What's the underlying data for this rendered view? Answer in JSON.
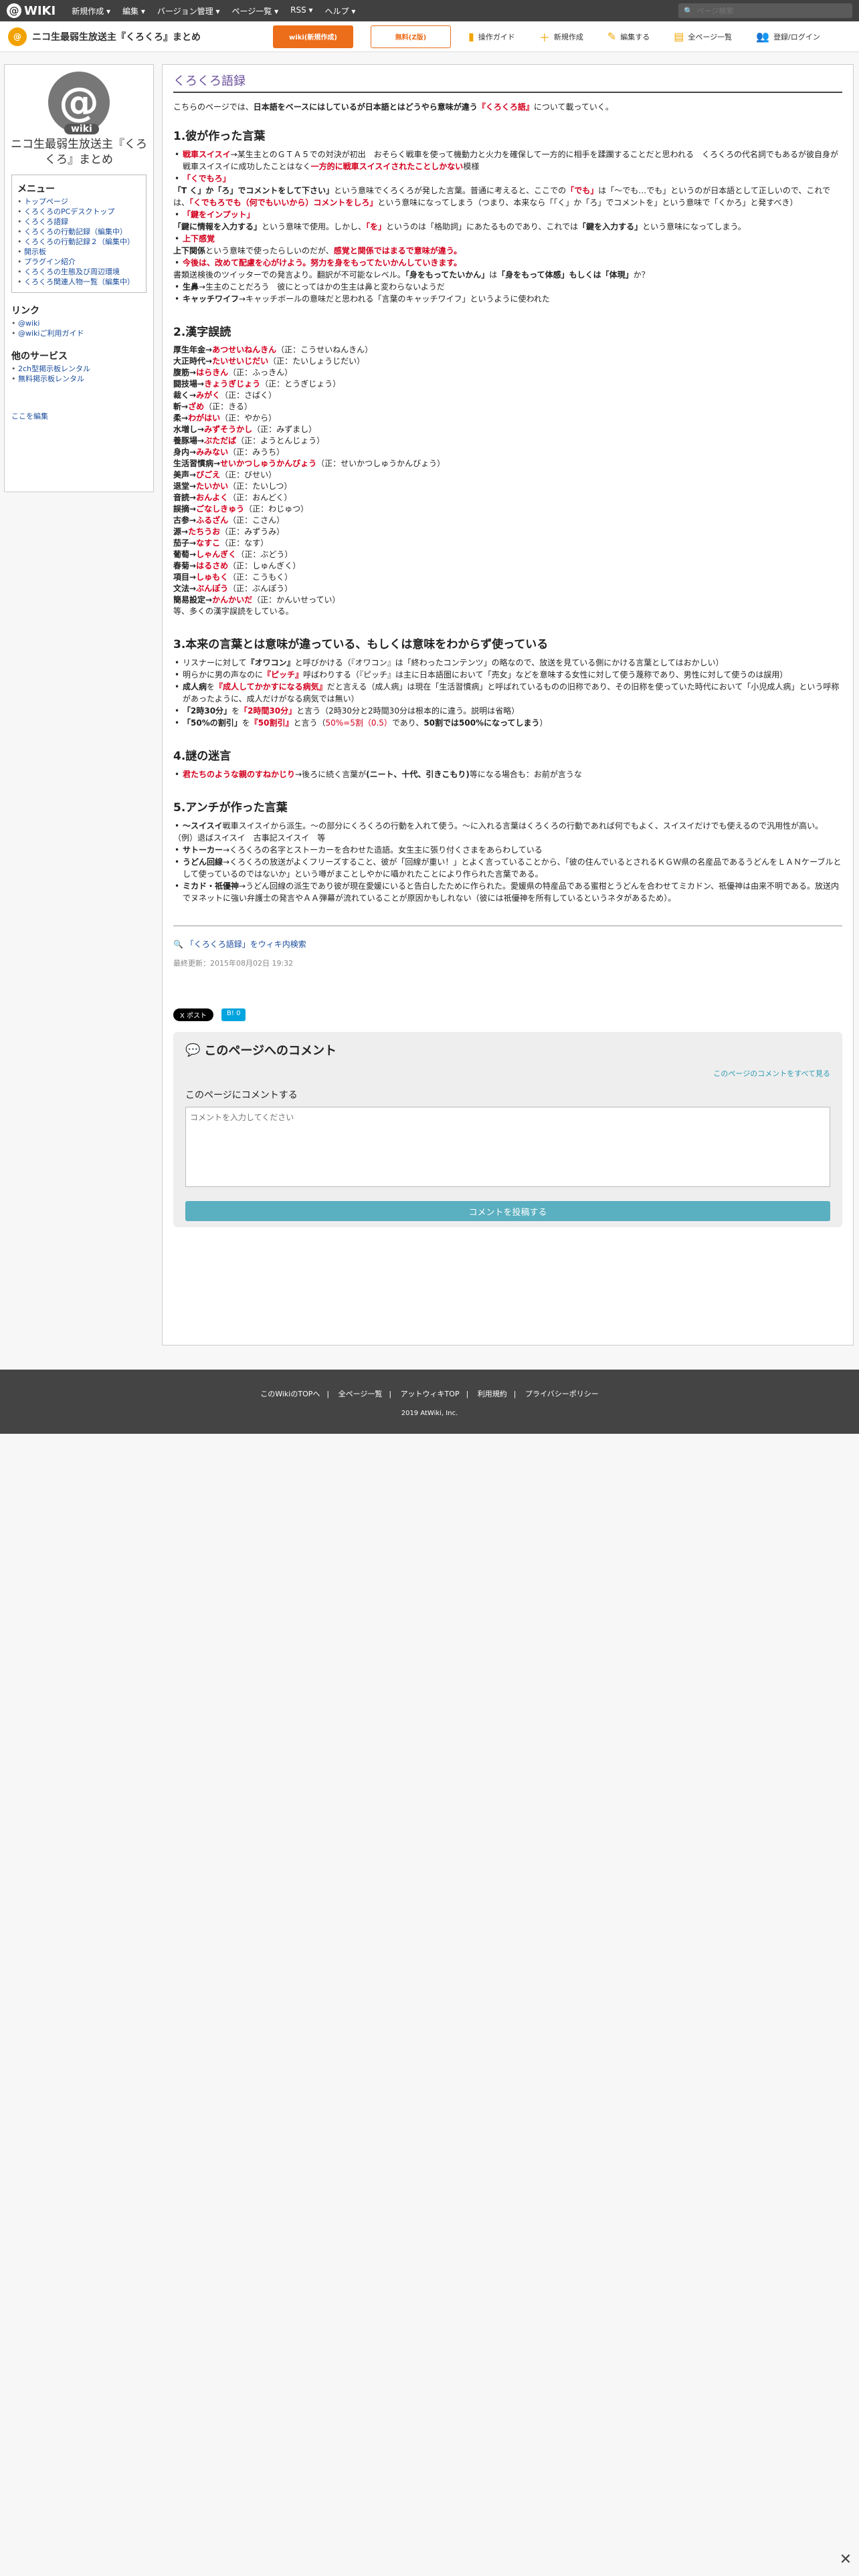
{
  "topbar": {
    "logo": "WIKI",
    "nav": [
      "新規作成 ▾",
      "編集 ▾",
      "バージョン管理 ▾",
      "ページ一覧 ▾",
      "RSS ▾",
      "ヘルプ ▾"
    ],
    "search_placeholder": "ページ検索"
  },
  "toolbar": {
    "site_title": "ニコ生最弱生放送主『くろくろ』まとめ",
    "btn_wiki": "wiki(新規作成)",
    "btn_free": "無料(Z版)",
    "items": [
      "操作ガイド",
      "新規作成",
      "編集する",
      "全ページ一覧",
      "登録/ログイン"
    ]
  },
  "sidebar": {
    "name": "ニコ生最弱生放送主『くろくろ』まとめ",
    "menu_title": "メニュー",
    "menu": [
      "トップページ",
      "くろくろのPCデスクトップ",
      "くろくろ語録",
      "くろくろの行動記録（編集中）",
      "くろくろの行動記録２（編集中）",
      "開示板",
      "プラグイン紹介",
      "くろくろの生態及び周辺環境",
      "くろくろ関連人物一覧（編集中）"
    ],
    "links_title": "リンク",
    "links": [
      "@wiki",
      "@wikiご利用ガイド"
    ],
    "other_title": "他のサービス",
    "other": [
      "2ch型掲示板レンタル",
      "無料掲示板レンタル"
    ],
    "edit": "ここを編集"
  },
  "main": {
    "title": "くろくろ語録",
    "intro_a": "こちらのページでは、",
    "intro_b": "日本語をベースにはしているが日本語とはどうやら意味が違う",
    "intro_c": "『くろくろ語』",
    "intro_d": "について載っていく。",
    "s1_title": "1.彼が作った言葉",
    "s1": {
      "a1": "戦車スイスイ",
      "a2": "→某生主とのＧＴＡ５での対決が初出　おそらく戦車を使って機動力と火力を確保して一方的に相手を蹂躙することだと思われる　くろくろの代名詞でもあるが彼自身が戦車スイスイに成功したことはなく",
      "a3": "一方的に戦車スイスイされたことしかない",
      "a4": "模様",
      "b1": "「くでもろ」",
      "c1": "「T く」か「ろ」でコメントをして下さい」",
      "c2": "という意味でくろくろが発した言葉。普通に考えると、ここでの",
      "c3": "「でも」",
      "c4": "は「〜でも…でも」というのが日本語として正しいので、これでは、",
      "c5": "「くでもろでも（何でもいいから）コメントをしろ」",
      "c6": "という意味になってしまう（つまり、本来なら「「く」か「ろ」でコメントを」という意味で「くかろ」と発すべき）",
      "d1": "「鍵をインプット」",
      "e1": "「鍵に情報を入力する」",
      "e2": "という意味で使用。しかし、",
      "e3": "「を」",
      "e4": "というのは「格助詞」にあたるものであり、これでは",
      "e5": "「鍵を入力する」",
      "e6": "という意味になってしまう。",
      "f1": "上下感覚",
      "g1": "上下関係",
      "g2": "という意味で使ったらしいのだが、",
      "g3": "感覚と関係ではまるで意味が違う。",
      "h1": "今後は、改めて配慮を心がけよう。努力を身をもってたいかんしていきます。",
      "i1": "書類送検後のツイッターでの発言より。翻訳が不可能なレベル。",
      "i2": "「身をもってたいかん」",
      "i3": "は",
      "i4": "「身をもって体感」もしくは「体現」",
      "i5": "か？",
      "j1": "生鼻",
      "j2": "→生主のことだろう　彼にとってはかの生主は鼻と変わらないようだ",
      "k1": "キャッチワイフ",
      "k2": "→キャッチボールの意味だと思われる「言葉のキャッチワイフ」というように使われた"
    },
    "s2_title": "2.漢字誤読",
    "s2": [
      {
        "w": "厚生年金→",
        "r": "あつせいねんきん",
        "n": "（正：こうせいねんきん）"
      },
      {
        "w": "大正時代→",
        "r": "たいせいじだい",
        "n": "（正：たいしょうじだい）"
      },
      {
        "w": "腹筋→",
        "r": "はらきん",
        "n": "（正：ふっきん）"
      },
      {
        "w": "闘技場→",
        "r": "きょうぎじょう",
        "n": "（正：とうぎじょう）"
      },
      {
        "w": "裁く→",
        "r": "みがく",
        "n": "（正：さばく）"
      },
      {
        "w": "斬→",
        "r": "ざめ",
        "n": "（正：きる）"
      },
      {
        "w": "柔→",
        "r": "わがはい",
        "n": "（正：やから）"
      },
      {
        "w": "水増し→",
        "r": "みずそうかし",
        "n": "（正：みずまし）"
      },
      {
        "w": "養豚場→",
        "r": "ぶただば",
        "n": "（正：ようとんじょう）"
      },
      {
        "w": "身内→",
        "r": "みみない",
        "n": "（正：みうち）"
      },
      {
        "w": "生活習慣病→",
        "r": "せいかつしゅうかんびょう",
        "n": "（正：せいかつしゅうかんびょう）"
      },
      {
        "w": "美声→",
        "r": "びごえ",
        "n": "（正：びせい）"
      },
      {
        "w": "退堂→",
        "r": "たいかい",
        "n": "（正：たいしつ）"
      },
      {
        "w": "音読→",
        "r": "おんよく",
        "n": "（正：おんどく）"
      },
      {
        "w": "誤摘→",
        "r": "ごなしきゅう",
        "n": "（正：わじゅつ）"
      },
      {
        "w": "古参→",
        "r": "ふるざん",
        "n": "（正：こさん）"
      },
      {
        "w": "源→",
        "r": "たちうお",
        "n": "（正：みずうみ）"
      },
      {
        "w": "茄子→",
        "r": "なすこ",
        "n": "（正：なす）"
      },
      {
        "w": "葡萄→",
        "r": "しゃんぎく",
        "n": "（正：ぶどう）"
      },
      {
        "w": "春菊→",
        "r": "はるさめ",
        "n": "（正：しゅんぎく）"
      },
      {
        "w": "項目→",
        "r": "しゅもく",
        "n": "（正：こうもく）"
      },
      {
        "w": "文法→",
        "r": "ぶんぽう",
        "n": "（正：ぶんぽう）"
      },
      {
        "w": "簡易設定→",
        "r": "かんかいだ",
        "n": "（正：かんいせってい）"
      }
    ],
    "s2_note": "等、多くの漢字誤読をしている。",
    "s3_title": "3.本来の言葉とは意味が違っている、もしくは意味をわからず使っている",
    "s3": {
      "a1": "リスナーに対して",
      "a2": "『オワコン』",
      "a3": "と呼びかける（『オワコン』は「終わったコンテンツ」の略なので、放送を見ている側にかける言葉としてはおかしい）",
      "b1": "明らかに男の声なのに",
      "b2": "『ピッチ』",
      "b3": "呼ばわりする（『ピッチ』は主に日本語圏において「売女」などを意味する女性に対して使う蔑称であり、男性に対して使うのは誤用）",
      "c1": "成人病",
      "c2": "を",
      "c3": "『成人してかかすになる病気』",
      "c4": "だと言える（成人病」は現在「生活習慣病」と呼ばれているものの旧称であり、その旧称を使っていた時代において「小児成人病」という呼称があったように、成人だけがなる病気では無い）",
      "d1": "「2時30分」",
      "d2": "を",
      "d3": "「2時間30分」",
      "d4": "と言う（2時30分と2時間30分は根本的に違う。説明は省略）",
      "e1": "「50%の割引」",
      "e2": "を",
      "e3": "『50割引』",
      "e4": "と言う（",
      "e5": "50%=5割（0.5）",
      "e6": "であり、",
      "e7": "50割では500%になってしまう",
      "e8": "）"
    },
    "s4_title": "4.謎の迷言",
    "s4": {
      "a1": "君たちのような親のすねかじり",
      "a2": "→後ろに続く言葉が",
      "a3": "(ニート、十代、引きこもり)",
      "a4": "等になる場合も：お前が言うな"
    },
    "s5_title": "5.アンチが作った言葉",
    "s5": {
      "a1": "〜スイスイ",
      "a2": "戦車スイスイから派生。〜の部分にくろくろの行動を入れて使う。〜に入れる言葉はくろくろの行動であれば何でもよく、スイスイだけでも使えるので汎用性が高い。",
      "b1": "（例）退ばスイスイ　古事記スイスイ　等",
      "c1": "サトーカー",
      "c2": "くろくろの名字とストーカーを合わせた造語。女生主に張り付くさまをあらわしている",
      "d1": "うどん回線",
      "d2": "くろくろの放送がよくフリーズすること、彼が「回線が重い！」とよく言っていることから、「彼の住んでいるとされるＫＧＷ県の名産品であるうどんをＬＡＮケーブルとして使っているのではないか」という噂がまことしやかに囁かれたことにより作られた言葉である。",
      "e1": "ミカド・祇優神",
      "e2": "うどん回線の派生であり彼が現在愛媛にいると告白したために作られた。愛媛県の特産品である蜜柑とうどんを合わせてミカドン、祇優神は由来不明である。放送内でヌネットに強い弁護士の発言やＡＡ弾幕が流れていることが原因かもしれない（彼には祇優神を所有しているというネタがあるため）。"
    },
    "search_link": "「くろくろ語録」をウィキ内検索",
    "updated": "最終更新：2015年08月02日 19:32"
  },
  "social": {
    "x": "X ポスト",
    "b": "B! 0"
  },
  "comments": {
    "title": "このページへのコメント",
    "all": "このページのコメントをすべて見る",
    "label": "このページにコメントする",
    "placeholder": "コメントを入力してください",
    "submit": "コメントを投稿する"
  },
  "footer": {
    "links": [
      "このWikiのTOPへ",
      "全ページ一覧",
      "アットウィキTOP",
      "利用規約",
      "プライバシーポリシー"
    ],
    "copy": "2019 AtWiki, Inc."
  }
}
